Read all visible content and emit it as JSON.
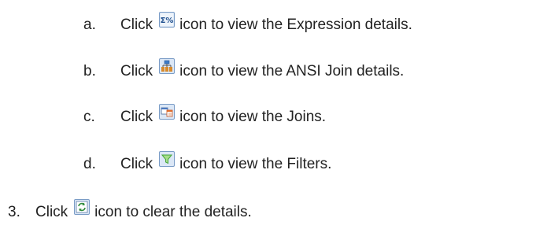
{
  "items": [
    {
      "marker": "a.",
      "prefix": "Click",
      "icon": "expression-icon",
      "suffix": "icon to view the Expression details."
    },
    {
      "marker": "b.",
      "prefix": "Click",
      "icon": "ansi-join-icon",
      "suffix": "icon to view the ANSI Join details."
    },
    {
      "marker": "c.",
      "prefix": "Click",
      "icon": "joins-icon",
      "suffix": "icon to view the Joins."
    },
    {
      "marker": "d.",
      "prefix": "Click",
      "icon": "filter-icon",
      "suffix": "icon to view the Filters."
    },
    {
      "marker": "3.",
      "prefix": "Click",
      "icon": "clear-details-icon",
      "suffix": "icon to clear the details."
    }
  ],
  "expression_icon_text": "Σ%",
  "colors": {
    "text": "#222222",
    "icon_border": "#7a9cc6",
    "icon_fill": "#dbe7f6",
    "filter_green": "#46a63a",
    "clear_green": "#2e8b3b",
    "join_orange": "#d88a2b"
  }
}
